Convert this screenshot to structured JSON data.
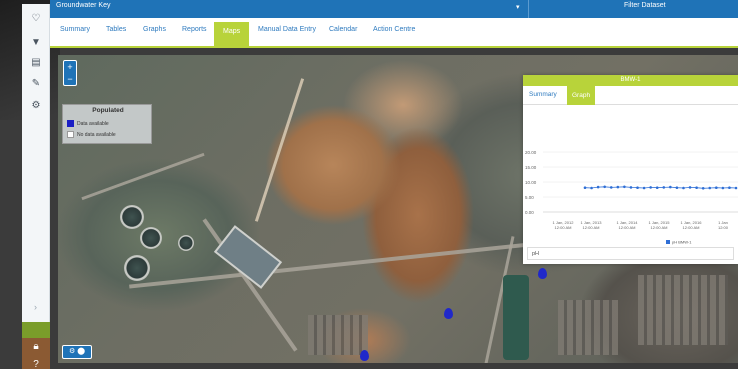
{
  "topbar": {
    "title": "Groundwater Key",
    "filter_label": "Filter Dataset"
  },
  "tabs": [
    {
      "label": "Summary"
    },
    {
      "label": "Tables"
    },
    {
      "label": "Graphs"
    },
    {
      "label": "Reports"
    },
    {
      "label": "Maps",
      "active": true
    },
    {
      "label": "Manual Data Entry"
    },
    {
      "label": "Calendar"
    },
    {
      "label": "Action Centre"
    }
  ],
  "sidebar": {
    "icons": [
      "heart-icon",
      "filter-icon",
      "list-icon",
      "edit-icon",
      "settings-icon"
    ]
  },
  "map": {
    "zoom_in": "+",
    "zoom_out": "−",
    "legend": {
      "title": "Populated",
      "items": [
        {
          "label": "Data available",
          "color": "#1a1ec4"
        },
        {
          "label": "No data available",
          "color": "#ffffff"
        }
      ]
    },
    "pin_color": "#2028c9"
  },
  "popup": {
    "title": "BMW-1",
    "tabs": [
      {
        "label": "Summary"
      },
      {
        "label": "Graph",
        "active": true
      }
    ],
    "footer": "pH"
  },
  "chart_data": {
    "type": "line",
    "y_ticks": [
      "20.00",
      "15.00",
      "10.00",
      "5.00",
      "0.00"
    ],
    "ylim": [
      0,
      20
    ],
    "x_ticks": [
      [
        "1 Jan, 2012",
        "12:00 AM"
      ],
      [
        "1 Jan, 2013",
        "12:00 AM"
      ],
      [
        "1 Jan, 2014",
        "12:00 AM"
      ],
      [
        "1 Jan, 2015",
        "12:00 AM"
      ],
      [
        "1 Jan, 2016",
        "12:00 AM"
      ],
      [
        "1 Jan",
        "12:00"
      ]
    ],
    "series": [
      {
        "name": "pH BMW-1",
        "color": "#2f6fd6",
        "values": [
          8.1,
          8.0,
          8.3,
          8.4,
          8.2,
          8.3,
          8.4,
          8.2,
          8.1,
          8.0,
          8.2,
          8.1,
          8.2,
          8.3,
          8.1,
          8.0,
          8.2,
          8.1,
          7.9,
          8.0,
          8.1,
          8.0,
          8.1,
          8.0
        ]
      }
    ]
  }
}
